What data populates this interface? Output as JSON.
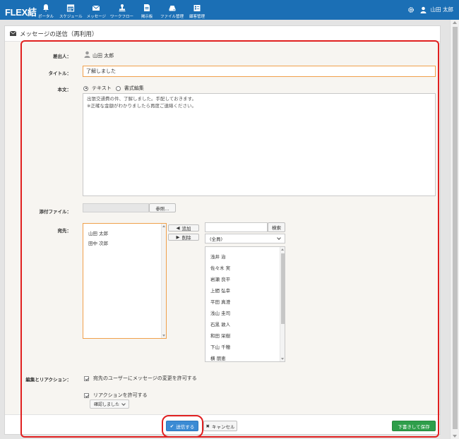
{
  "app": {
    "logo": "FLEX結"
  },
  "nav": [
    {
      "label": "ポータル",
      "icon": "bell-icon"
    },
    {
      "label": "スケジュール",
      "icon": "calendar-icon"
    },
    {
      "label": "メッセージ",
      "icon": "mail-icon"
    },
    {
      "label": "ワークフロー",
      "icon": "stamp-icon"
    },
    {
      "label": "掲示板",
      "icon": "board-icon"
    },
    {
      "label": "ファイル管理",
      "icon": "drive-icon"
    },
    {
      "label": "顧客管理",
      "icon": "customer-icon"
    }
  ],
  "user": {
    "name": "山田 太郎"
  },
  "page": {
    "title": "メッセージの送信（再利用）"
  },
  "form": {
    "sender_label": "差出人：",
    "sender_name": "山田 太郎",
    "title_label": "タイトル：",
    "title_value": "了解しました",
    "body_label": "本文：",
    "mode_text": "テキスト",
    "mode_rich": "書式編集",
    "body_line1": "出張交通費の件、了解しました。手配しておきます。",
    "body_line2": "※正確な金額がわかりましたら再度ご連絡ください。",
    "attach_label": "添付ファイル：",
    "browse_label": "参照...",
    "to_label": "宛先：",
    "recipients": [
      "山田 太郎",
      "田中 次郎"
    ],
    "add_label": "追加",
    "remove_label": "削除",
    "search_label": "検索",
    "group_select": "(全員)",
    "users": [
      "浅井 治",
      "佐々木 実",
      "岩瀬 良平",
      "上間 弘幸",
      "平田 真澄",
      "浅山 圭司",
      "石黒 敦人",
      "和田 栄樹",
      "下山 千穂",
      "横 朋恵"
    ],
    "edit_label": "編集とリアクション：",
    "allow_edit": "宛先のユーザーにメッセージの変更を許可する",
    "allow_reaction": "リアクションを許可する",
    "reaction_select": "確認しました"
  },
  "footer": {
    "send_label": "送信する",
    "cancel_label": "キャンセル",
    "draft_label": "下書きして保存"
  },
  "colors": {
    "topbar": "#1b6fb5",
    "send": "#3b8bd4",
    "draft": "#2e9e4a",
    "highlight": "#e02020",
    "focus": "#f0a04b"
  }
}
